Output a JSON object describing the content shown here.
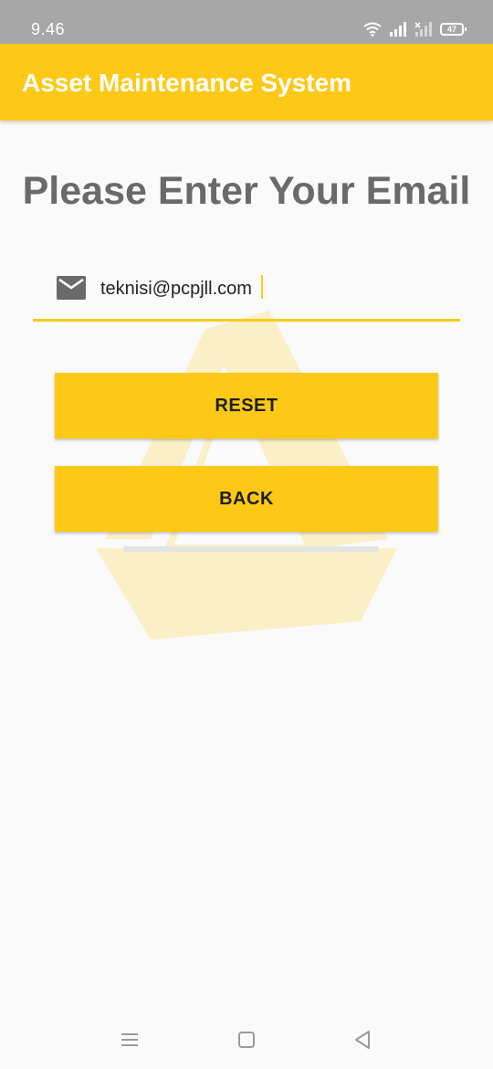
{
  "status_bar": {
    "time": "9.46",
    "battery": "47",
    "icons": [
      "wifi-icon",
      "signal-icon",
      "signal-off-icon",
      "battery-icon"
    ]
  },
  "app_bar": {
    "title": "Asset Maintenance System",
    "color": "#fdc916"
  },
  "form": {
    "heading": "Please Enter Your Email",
    "email_value": "teknisi@pcpjll.com",
    "email_icon": "mail-icon",
    "reset_label": "RESET",
    "back_label": "BACK"
  },
  "nav_bar": {
    "icons": [
      "menu-icon",
      "home-icon",
      "back-icon"
    ]
  },
  "colors": {
    "accent": "#fdc916",
    "heading": "#6a6a6a",
    "status_bar": "#a7a7a7"
  }
}
